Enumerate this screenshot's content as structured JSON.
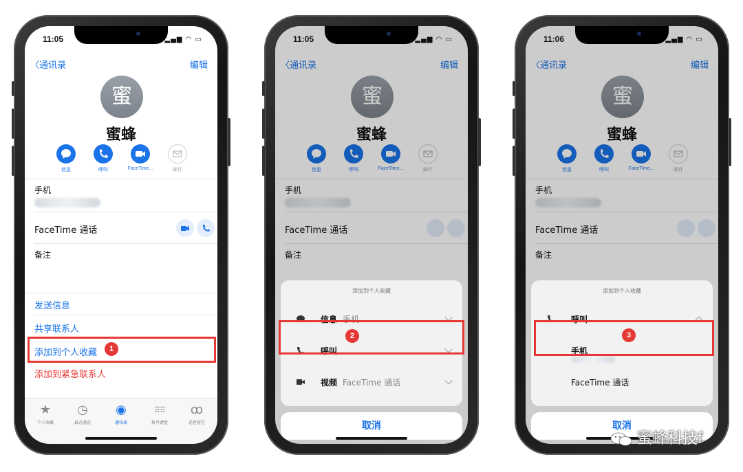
{
  "status": {
    "screen1_time": "11:05",
    "screen2_time": "11:05",
    "screen3_time": "11:06"
  },
  "nav": {
    "back_label": "通讯录",
    "edit_label": "编辑"
  },
  "contact": {
    "avatar_char": "蜜",
    "name": "蜜蜂"
  },
  "actions": {
    "message": "信息",
    "call": "呼叫",
    "facetime": "FaceTime...",
    "mail": "邮件"
  },
  "fields": {
    "mobile_label": "手机",
    "facetime_label": "FaceTime 通话",
    "notes_label": "备注"
  },
  "links": {
    "send_message": "发送信息",
    "share_contact": "共享联系人",
    "add_favorite": "添加到个人收藏",
    "add_emergency": "添加到紧急联系人"
  },
  "tabs": {
    "favorites": "个人收藏",
    "recents": "最近通话",
    "contacts": "通讯录",
    "keypad": "拨号键盘",
    "voicemail": "语音留言"
  },
  "sheet": {
    "title": "添加到个人收藏",
    "message_label": "信息",
    "message_sub": "手机",
    "call_label": "呼叫",
    "video_label": "视频",
    "video_sub": "FaceTime 通话",
    "mobile_option": "手机",
    "facetime_option": "FaceTime 通话",
    "cancel": "取消"
  },
  "badges": {
    "one": "1",
    "two": "2",
    "three": "3"
  },
  "watermark": {
    "text": "蜜蜂科技f"
  },
  "colors": {
    "accent": "#1a73e8",
    "highlight": "#e53935"
  }
}
